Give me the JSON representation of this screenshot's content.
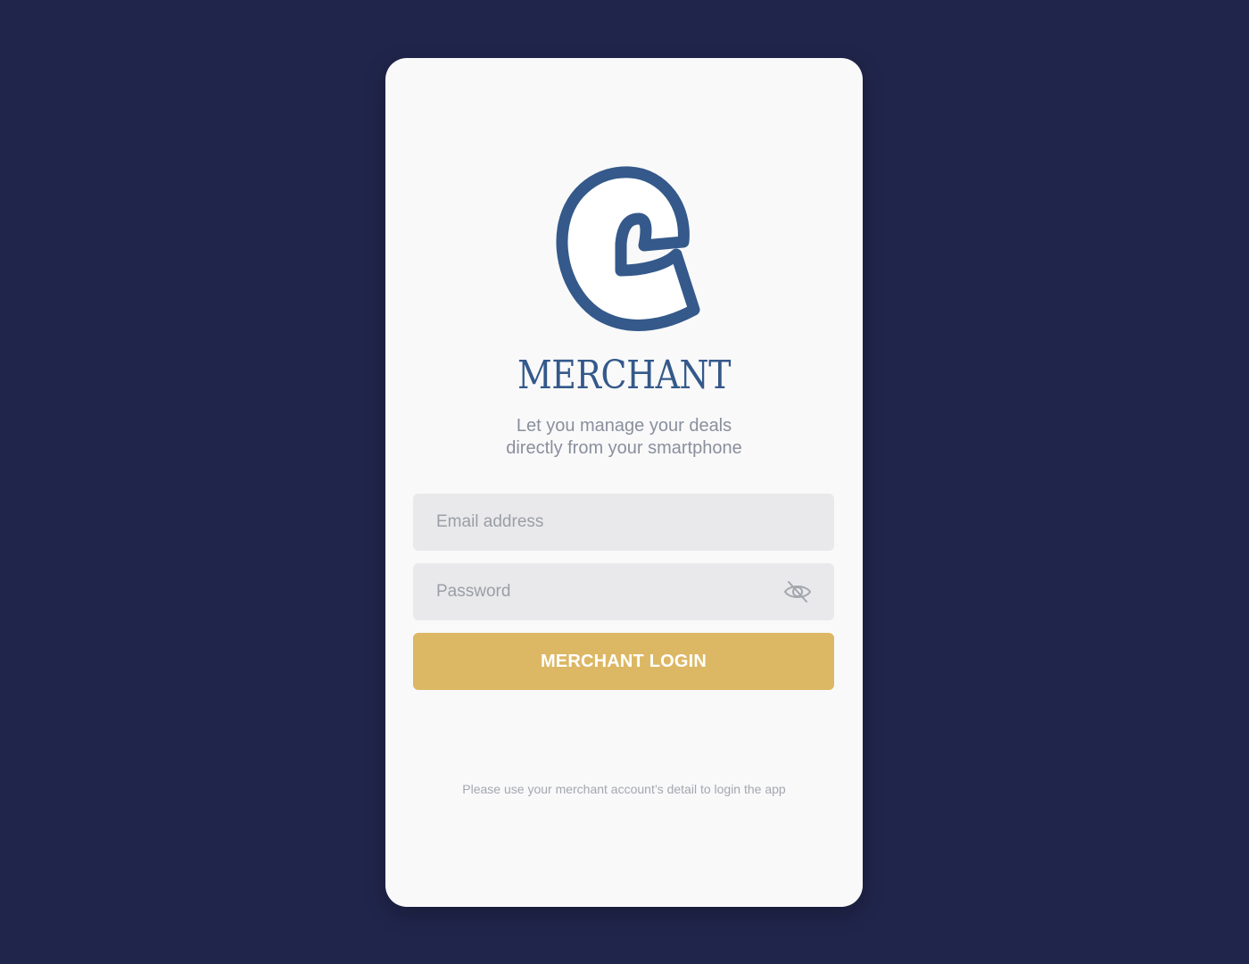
{
  "brand": {
    "name": "MERCHANT",
    "logo_icon": "merchant-c-logo",
    "color": "#34598a"
  },
  "tagline": {
    "line1": "Let you manage your deals",
    "line2": "directly from your smartphone"
  },
  "form": {
    "email_placeholder": "Email address",
    "email_value": "",
    "password_placeholder": "Password",
    "password_value": "",
    "password_toggle_icon": "eye-slash-icon",
    "login_label": "MERCHANT LOGIN"
  },
  "footnote": "Please use your merchant account’s detail to login the app",
  "colors": {
    "background": "#20254b",
    "card": "#f9f9fa",
    "field": "#e9e9eb",
    "button": "#dcb764",
    "muted_text": "#8a8f9c"
  }
}
